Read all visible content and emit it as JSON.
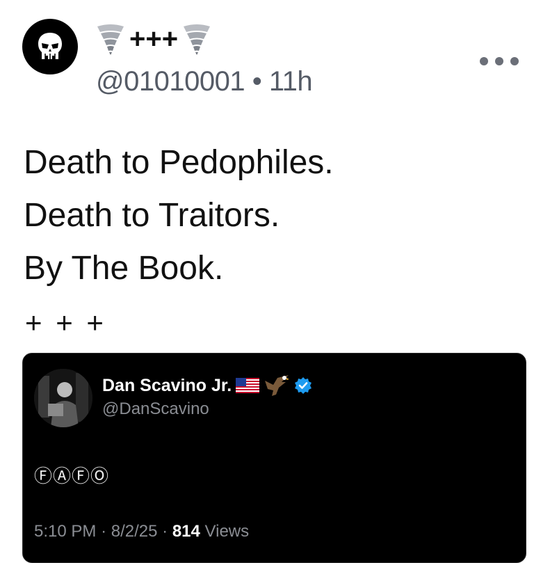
{
  "post": {
    "author": {
      "display_name": "+++",
      "handle": "@01010001",
      "time_ago": "11h",
      "separator": "•",
      "avatar_icon": "skull-icon",
      "name_icons": [
        "tornado-emoji",
        "tornado-emoji"
      ]
    },
    "more_icon": "more-horizontal-icon",
    "lines": [
      "Death to Pedophiles.",
      "Death to Traitors.",
      "By The Book."
    ],
    "footer": "+ + +"
  },
  "quote": {
    "name": "Dan Scavino Jr.",
    "name_icons": [
      "us-flag-emoji",
      "eagle-emoji",
      "verified-badge-icon"
    ],
    "handle": "@DanScavino",
    "text": "ⒻⒶⒻⓄ",
    "time": "5:10 PM",
    "date": "8/2/25",
    "dot": "·",
    "views_count": "814",
    "views_label": "Views",
    "colors": {
      "card_bg": "#000000",
      "verified": "#1d9bf0"
    }
  }
}
